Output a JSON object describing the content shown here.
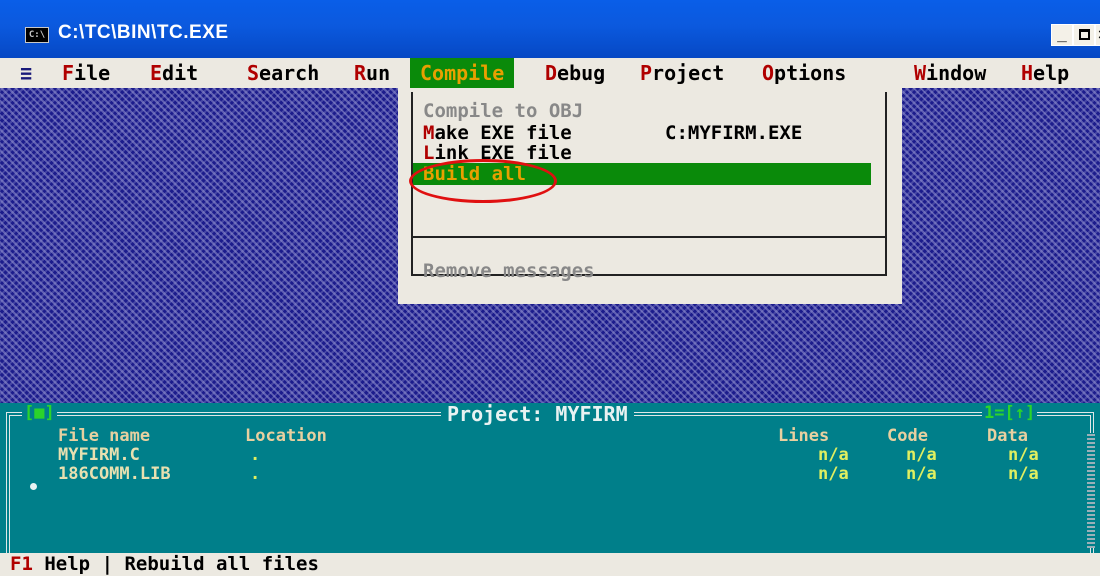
{
  "window": {
    "title": "C:\\TC\\BIN\\TC.EXE",
    "icon_label": "C:\\",
    "minimize_label": "_",
    "close_label": "×"
  },
  "menubar": {
    "system_menu": "≡",
    "items": [
      {
        "hotkey": "F",
        "rest": "ile"
      },
      {
        "hotkey": "E",
        "rest": "dit"
      },
      {
        "hotkey": "S",
        "rest": "earch"
      },
      {
        "hotkey": "R",
        "rest": "un"
      },
      {
        "hotkey": "C",
        "rest": "ompile"
      },
      {
        "hotkey": "D",
        "rest": "ebug"
      },
      {
        "hotkey": "P",
        "rest": "roject"
      },
      {
        "hotkey": "O",
        "rest": "ptions"
      },
      {
        "hotkey": "W",
        "rest": "indow"
      },
      {
        "hotkey": "H",
        "rest": "elp"
      }
    ],
    "active": "Compile"
  },
  "compile_menu": {
    "items": [
      {
        "hotkey": "",
        "rest": "Compile to OBJ",
        "state": "disabled"
      },
      {
        "hotkey": "M",
        "rest": "ake EXE file",
        "shortcut": "C:MYFIRM.EXE",
        "state": "enabled"
      },
      {
        "hotkey": "L",
        "rest": "ink EXE file",
        "state": "enabled"
      },
      {
        "hotkey": "B",
        "rest": "uild all",
        "state": "selected"
      },
      {
        "hotkey": "",
        "rest": "Remove messages",
        "state": "disabled"
      }
    ]
  },
  "project_window": {
    "title": "Project: MYFIRM",
    "left_indicator": "[■]",
    "right_indicator": "1=[↑]",
    "columns": [
      "File name",
      "Location",
      "Lines",
      "Code",
      "Data"
    ],
    "rows": [
      {
        "file": "MYFIRM.C",
        "location": ".",
        "lines": "n/a",
        "code": "n/a",
        "data": "n/a"
      },
      {
        "file": "186COMM.LIB",
        "location": ".",
        "lines": "n/a",
        "code": "n/a",
        "data": "n/a"
      }
    ]
  },
  "statusbar": {
    "key": "F1",
    "key_label": "Help",
    "separator": "|",
    "message": "Rebuild all files"
  },
  "colors": {
    "title_blue": "#0a5ee8",
    "desktop_blue": "#1c1c8c",
    "menu_bg": "#ece9e1",
    "highlight_green": "#0a8a0a",
    "highlight_text": "#e8a000",
    "hotkey_red": "#b00000",
    "project_teal": "#007f8a",
    "annotation_red": "#e01010"
  }
}
